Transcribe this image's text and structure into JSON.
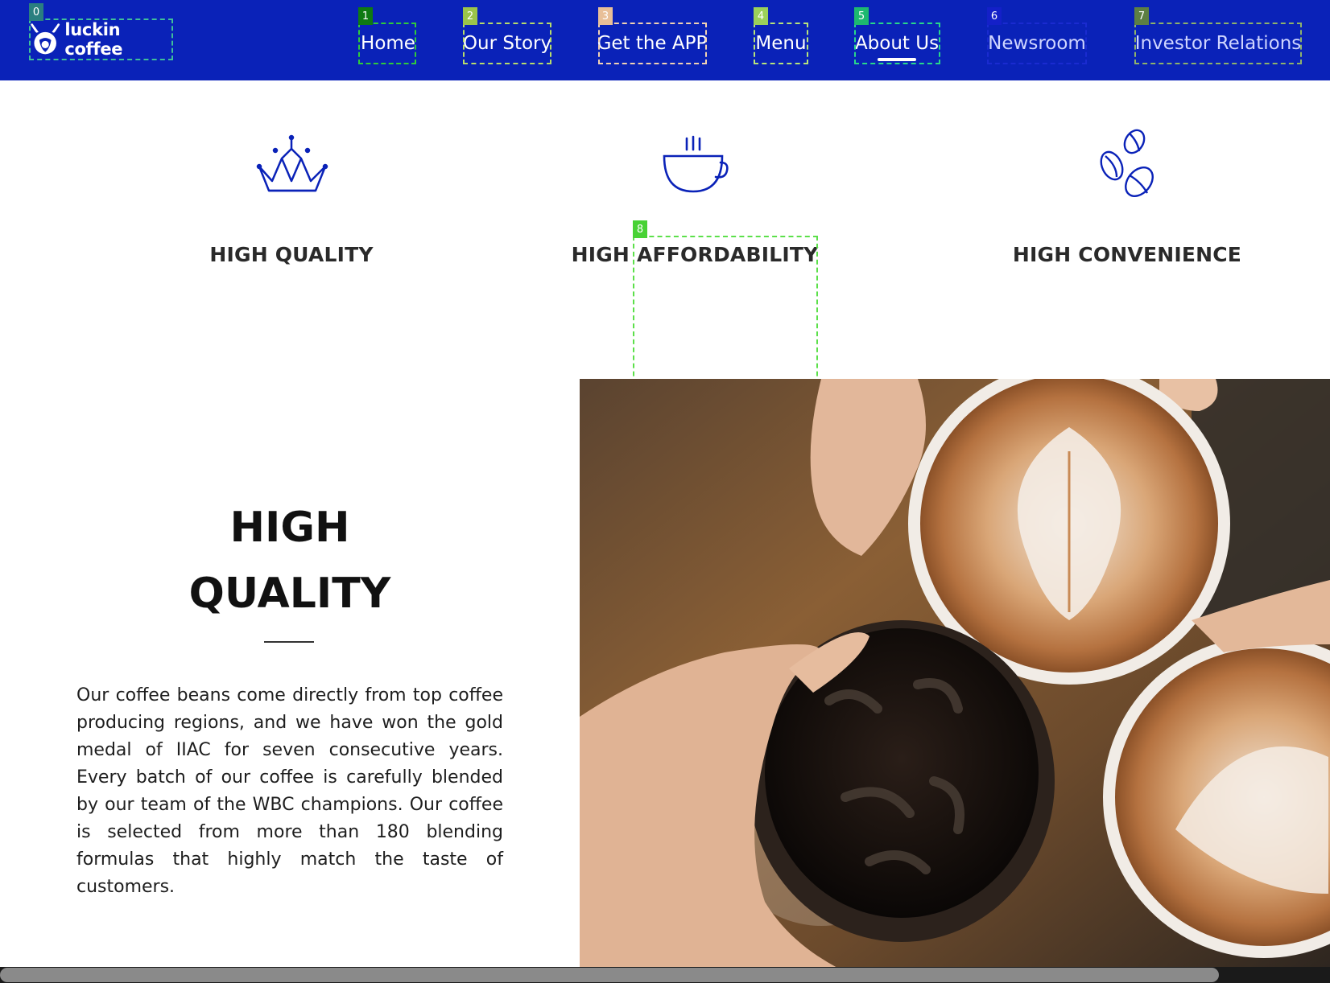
{
  "header": {
    "logo_text": "luckin coffee",
    "brand_color": "#0a22b8",
    "nav": [
      {
        "label": "Home"
      },
      {
        "label": "Our Story"
      },
      {
        "label": "Get the APP"
      },
      {
        "label": "Menu"
      },
      {
        "label": "About Us",
        "active": true
      },
      {
        "label": "Newsroom"
      },
      {
        "label": "Investor Relations"
      }
    ]
  },
  "overlay_tags": [
    "0",
    "1",
    "2",
    "3",
    "4",
    "5",
    "6",
    "7",
    "8"
  ],
  "features": [
    {
      "icon": "crown-icon",
      "title": "HIGH QUALITY"
    },
    {
      "icon": "coffee-cup-icon",
      "title": "HIGH AFFORDABILITY"
    },
    {
      "icon": "coffee-beans-icon",
      "title": "HIGH CONVENIENCE"
    }
  ],
  "quality": {
    "heading_line1": "HIGH",
    "heading_line2": "QUALITY",
    "body": "Our coffee beans come directly from top coffee producing regions, and we have won the gold medal of IIAC for seven consecutive years. Every batch of our coffee is carefully blended by our team of the WBC champions. Our coffee is selected from more than 180 blending formulas that highly match the taste of customers."
  },
  "photo": {
    "subject": "hands-toasting-coffee-cups-photo"
  },
  "colors": {
    "accent": "#0a22b8",
    "text_dark": "#111111"
  }
}
